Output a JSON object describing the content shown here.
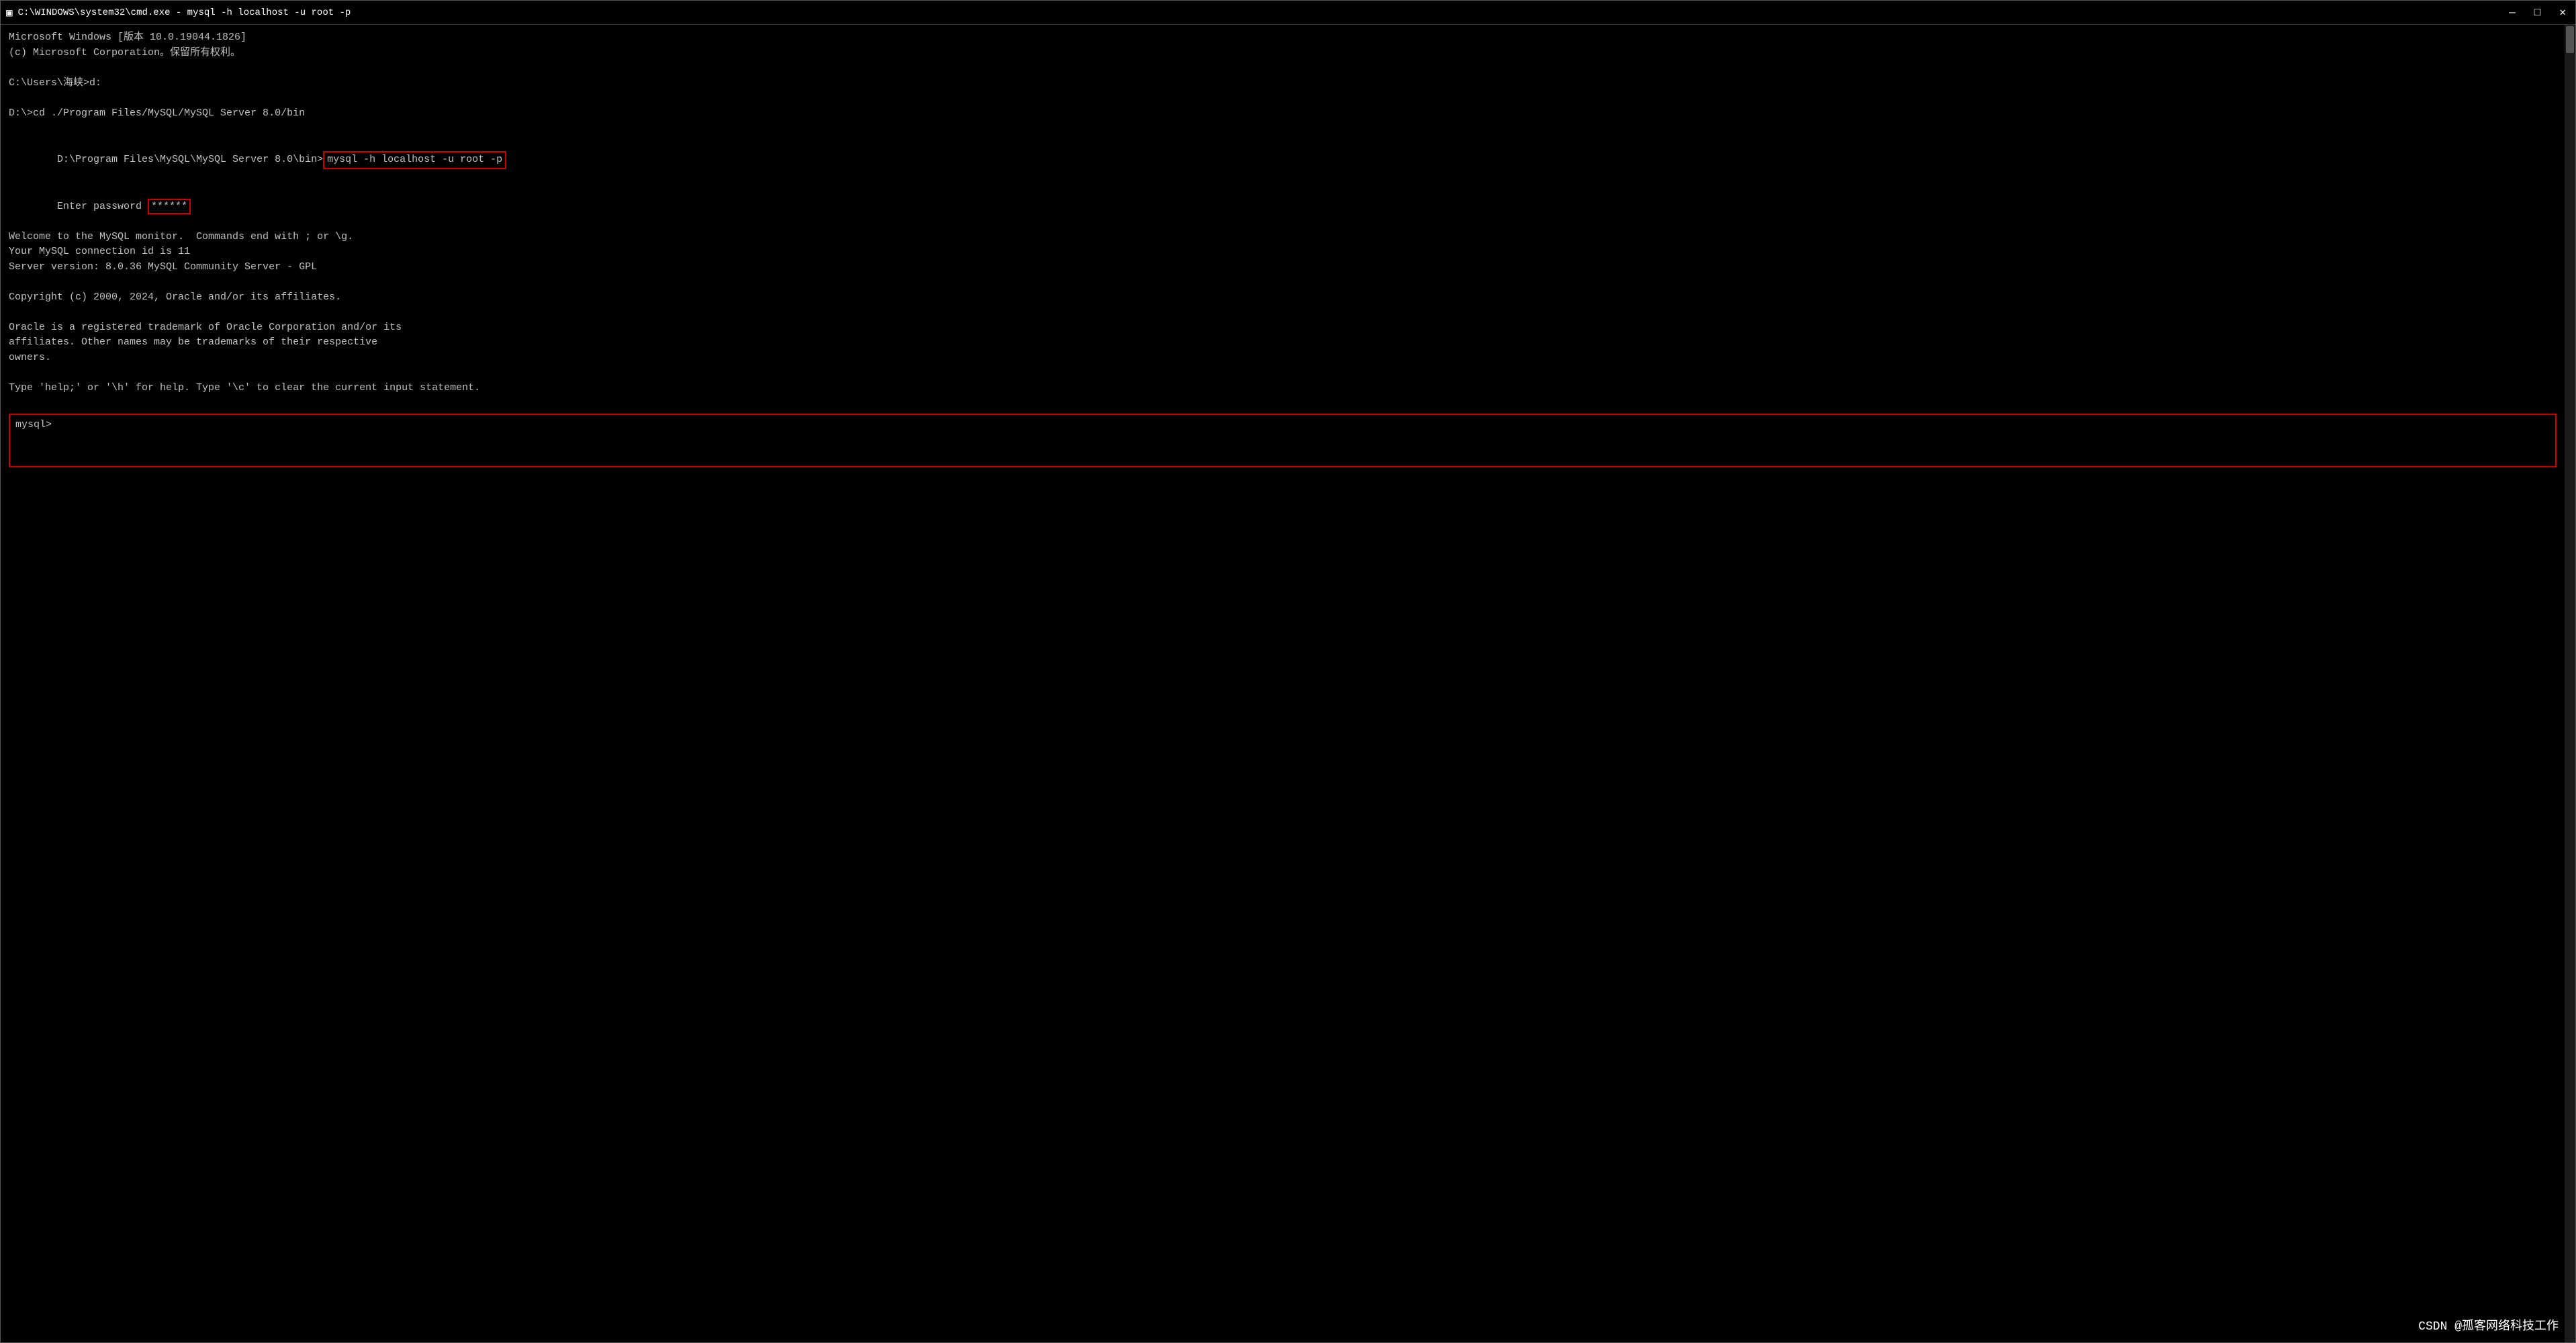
{
  "window": {
    "title": "C:\\WINDOWS\\system32\\cmd.exe - mysql  -h localhost -u root -p",
    "icon": "▣"
  },
  "titlebar": {
    "minimize_label": "—",
    "maximize_label": "□",
    "close_label": "✕"
  },
  "terminal": {
    "line1": "Microsoft Windows [版本 10.0.19044.1826]",
    "line2": "(c) Microsoft Corporation。保留所有权利。",
    "line3": "",
    "line4": "C:\\Users\\海峡>d:",
    "line5": "",
    "line6": "D:\\>cd ./Program Files/MySQL/MySQL Server 8.0/bin",
    "line7": "",
    "line8_prefix": "D:\\Program Files\\MySQL\\MySQL Server 8.0\\bin>",
    "line8_cmd": "mysql -h localhost -u root -p",
    "line9_prefix": "Enter password ",
    "line9_password": "******",
    "line10": "Welcome to the MySQL monitor.  Commands end with ; or \\g.",
    "line11": "Your MySQL connection id is 11",
    "line12": "Server version: 8.0.36 MySQL Community Server - GPL",
    "line13": "",
    "line14": "Copyright (c) 2000, 2024, Oracle and/or its affiliates.",
    "line15": "",
    "line16": "Oracle is a registered trademark of Oracle Corporation and/or its",
    "line17": "affiliates. Other names may be trademarks of their respective",
    "line18": "owners.",
    "line19": "",
    "line20": "Type 'help;' or '\\h' for help. Type '\\c' to clear the current input statement.",
    "line21": "",
    "prompt": "mysql> "
  },
  "watermark": "CSDN @孤客网络科技工作"
}
